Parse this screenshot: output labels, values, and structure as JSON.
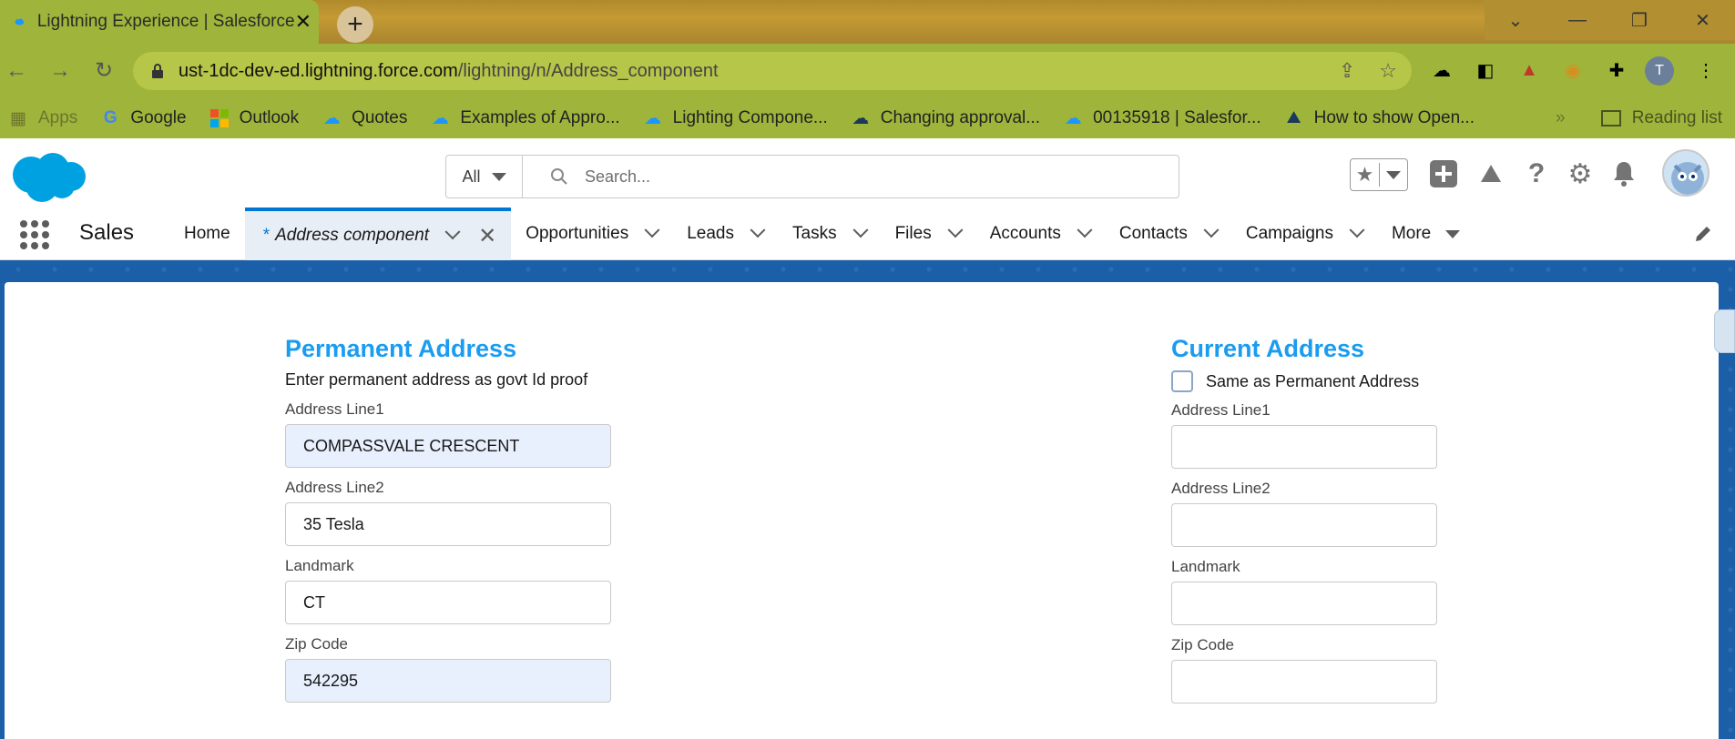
{
  "browser": {
    "tab_title": "Lightning Experience | Salesforce",
    "url_host": "ust-1dc-dev-ed.lightning.force.com",
    "url_path": "/lightning/n/Address_component",
    "profile_initial": "T",
    "bookmarks": [
      {
        "label": "Apps"
      },
      {
        "label": "Google"
      },
      {
        "label": "Outlook"
      },
      {
        "label": "Quotes"
      },
      {
        "label": "Examples of Appro..."
      },
      {
        "label": "Lighting Compone..."
      },
      {
        "label": "Changing approval..."
      },
      {
        "label": "00135918 | Salesfor..."
      },
      {
        "label": "How to show Open..."
      }
    ],
    "reading_list": "Reading list"
  },
  "header": {
    "search_scope": "All",
    "search_placeholder": "Search..."
  },
  "nav": {
    "app_name": "Sales",
    "home": "Home",
    "active_tab_marker": "*",
    "active_tab": "Address component",
    "items": [
      "Opportunities",
      "Leads",
      "Tasks",
      "Files",
      "Accounts",
      "Contacts",
      "Campaigns"
    ],
    "more": "More"
  },
  "permanent": {
    "title": "Permanent Address",
    "help": "Enter permanent address as govt Id proof",
    "line1_label": "Address Line1",
    "line1_value": "COMPASSVALE CRESCENT",
    "line2_label": "Address Line2",
    "line2_value": "35 Tesla",
    "landmark_label": "Landmark",
    "landmark_value": "CT",
    "zip_label": "Zip Code",
    "zip_value": "542295"
  },
  "current": {
    "title": "Current Address",
    "same_as_label": "Same as Permanent Address",
    "same_as_checked": false,
    "line1_label": "Address Line1",
    "line1_value": "",
    "line2_label": "Address Line2",
    "line2_value": "",
    "landmark_label": "Landmark",
    "landmark_value": "",
    "zip_label": "Zip Code",
    "zip_value": ""
  },
  "colors": {
    "section_title": "#1a9cf0",
    "brand_blue": "#0176d3",
    "autofill": "#e8f0fd"
  }
}
